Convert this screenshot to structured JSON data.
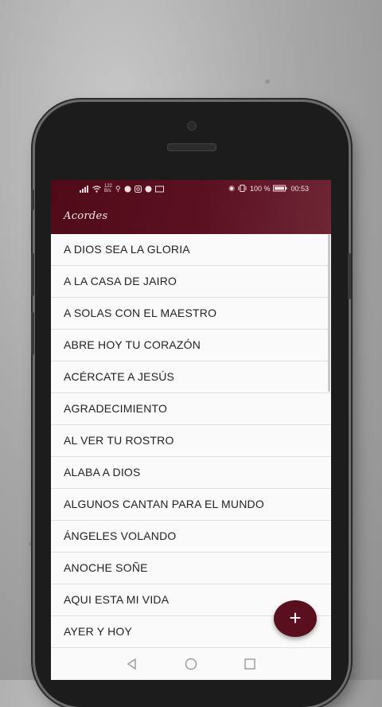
{
  "status_bar": {
    "net_speed_value": "122",
    "net_speed_unit": "B/s",
    "battery": "100 %",
    "time": "00:53"
  },
  "app_bar": {
    "title": "Acordes"
  },
  "songs": [
    "A DIOS SEA LA GLORIA",
    "A LA CASA DE JAIRO",
    "A SOLAS CON EL MAESTRO",
    "ABRE HOY TU CORAZÓN",
    "ACÉRCATE A JESÚS",
    "AGRADECIMIENTO",
    "AL VER TU ROSTRO",
    "ALABA A DIOS",
    "ALGUNOS CANTAN PARA EL MUNDO",
    "ÁNGELES VOLANDO",
    "ANOCHE SOÑE",
    "AQUI ESTA MI VIDA",
    "AYER Y HOY"
  ],
  "fab": {
    "icon": "plus-icon",
    "label": "+"
  },
  "nav_bar": {
    "icons": [
      "back-icon",
      "home-icon",
      "recents-icon"
    ]
  },
  "colors": {
    "primary": "#5a0f1f",
    "accent": "#5a0f1f",
    "list_bg": "#fafafa"
  }
}
